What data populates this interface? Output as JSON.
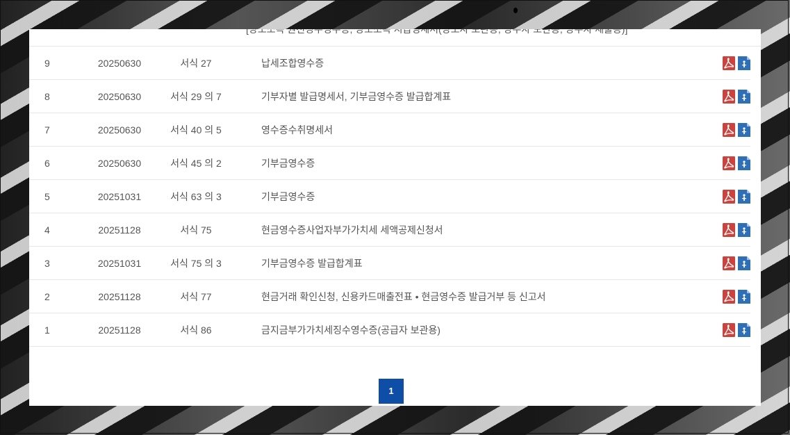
{
  "partial_row": {
    "title": "[양도소득 원천징수영수증, 양도소득 지급명세서(양도자 보관용, 양수자 보관용, 양수자 제출용)]"
  },
  "rows": [
    {
      "no": "9",
      "date": "20250630",
      "form": "서식 27",
      "title": "납세조합영수증"
    },
    {
      "no": "8",
      "date": "20250630",
      "form": "서식 29 의 7",
      "title": "기부자별 발급명세서, 기부금영수증 발급합계표"
    },
    {
      "no": "7",
      "date": "20250630",
      "form": "서식 40 의 5",
      "title": "영수증수취명세서"
    },
    {
      "no": "6",
      "date": "20250630",
      "form": "서식 45 의 2",
      "title": "기부금영수증"
    },
    {
      "no": "5",
      "date": "20251031",
      "form": "서식 63 의 3",
      "title": "기부금영수증"
    },
    {
      "no": "4",
      "date": "20251128",
      "form": "서식 75",
      "title": "현금영수증사업자부가가치세 세액공제신청서"
    },
    {
      "no": "3",
      "date": "20251031",
      "form": "서식 75 의 3",
      "title": "기부금영수증 발급합계표"
    },
    {
      "no": "2",
      "date": "20251128",
      "form": "서식 77",
      "title": "현금거래 확인신청, 신용카드매출전표 • 현금영수증 발급거부 등 신고서"
    },
    {
      "no": "1",
      "date": "20251128",
      "form": "서식 86",
      "title": "금지금부가가치세징수영수증(공급자 보관용)"
    }
  ],
  "icons": {
    "pdf": "pdf-file-icon",
    "hwp": "hwp-file-icon"
  },
  "colors": {
    "pdf": "#c9443f",
    "hwp": "#2f6fb5",
    "pager": "#0f4ea6"
  },
  "pagination": {
    "current": "1"
  }
}
